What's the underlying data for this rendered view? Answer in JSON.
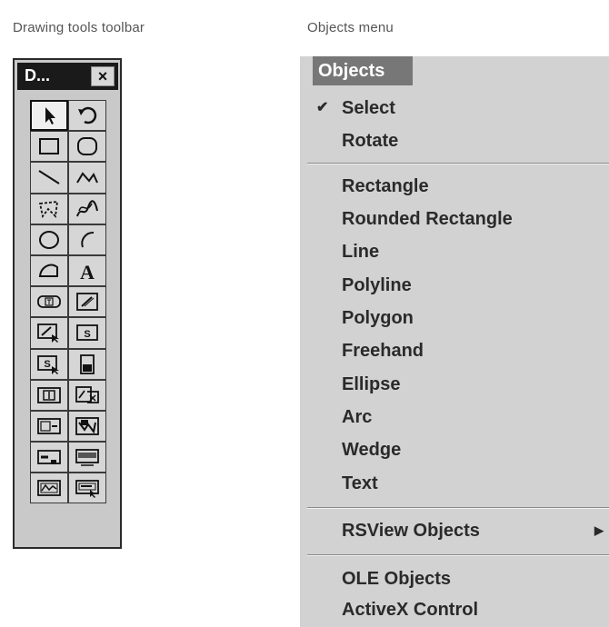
{
  "captions": {
    "toolbar": "Drawing tools toolbar",
    "menu": "Objects menu"
  },
  "toolbar": {
    "title": "D...",
    "close_label": "×",
    "tools": [
      {
        "icon": "select-arrow-icon"
      },
      {
        "icon": "rotate-icon"
      },
      {
        "icon": "rectangle-icon"
      },
      {
        "icon": "rounded-rectangle-icon"
      },
      {
        "icon": "line-icon"
      },
      {
        "icon": "polyline-icon"
      },
      {
        "icon": "polygon-icon"
      },
      {
        "icon": "freehand-icon"
      },
      {
        "icon": "ellipse-icon"
      },
      {
        "icon": "arc-icon"
      },
      {
        "icon": "wedge-icon"
      },
      {
        "icon": "text-icon",
        "text": "A"
      },
      {
        "icon": "text-input-icon"
      },
      {
        "icon": "numeric-display-icon"
      },
      {
        "icon": "numeric-input-icon"
      },
      {
        "icon": "string-display-icon"
      },
      {
        "icon": "string-input-icon"
      },
      {
        "icon": "bar-graph-icon"
      },
      {
        "icon": "button-icon"
      },
      {
        "icon": "multistate-indicator-icon"
      },
      {
        "icon": "list-indicator-icon"
      },
      {
        "icon": "symbol-icon"
      },
      {
        "icon": "arrow-indicator-icon"
      },
      {
        "icon": "message-display-icon"
      },
      {
        "icon": "trend-icon"
      },
      {
        "icon": "alarm-banner-icon"
      }
    ]
  },
  "menu": {
    "title": "Objects",
    "items": [
      {
        "label": "Select",
        "checked": true
      },
      {
        "label": "Rotate"
      },
      {
        "label": "Rectangle"
      },
      {
        "label": "Rounded Rectangle"
      },
      {
        "label": "Line"
      },
      {
        "label": "Polyline"
      },
      {
        "label": "Polygon"
      },
      {
        "label": "Freehand"
      },
      {
        "label": "Ellipse"
      },
      {
        "label": "Arc"
      },
      {
        "label": "Wedge"
      },
      {
        "label": "Text"
      },
      {
        "label": "RSView Objects",
        "submenu": true
      },
      {
        "label": "OLE Objects"
      },
      {
        "label": "ActiveX Control"
      }
    ]
  }
}
